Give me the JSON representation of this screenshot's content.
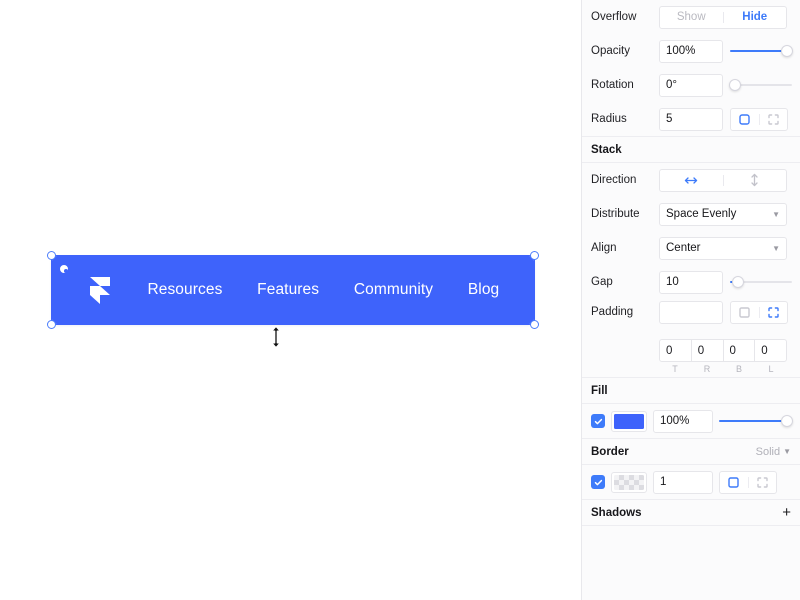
{
  "canvas": {
    "name": "design-canvas",
    "background": "#ffffff",
    "navbar": {
      "fill_color": "#3e63fb",
      "radius": 5,
      "logo_icon": "framer-logo-icon",
      "links": [
        {
          "label": "Resources"
        },
        {
          "label": "Features"
        },
        {
          "label": "Community"
        },
        {
          "label": "Blog"
        }
      ]
    },
    "selection": {
      "handles": [
        "top-left",
        "top-right",
        "bottom-left",
        "bottom-right"
      ],
      "radius_handle": "radius-handle",
      "cursor": "vertical-resize-cursor"
    }
  },
  "panel": {
    "overflow": {
      "label": "Overflow",
      "options": [
        "Show",
        "Hide"
      ],
      "selected": "Hide"
    },
    "opacity": {
      "label": "Opacity",
      "value": "100%",
      "slider_percent": 100
    },
    "rotation": {
      "label": "Rotation",
      "value": "0°",
      "slider_percent": 0
    },
    "radius": {
      "label": "Radius",
      "value": "5",
      "icons": [
        "square-radius-icon",
        "corners-radius-icon"
      ],
      "selected_icon": "square-radius-icon"
    },
    "stack": {
      "title": "Stack",
      "direction": {
        "label": "Direction",
        "icons": [
          "horizontal-arrows-icon",
          "vertical-arrows-icon"
        ],
        "selected_icon": "horizontal-arrows-icon"
      },
      "distribute": {
        "label": "Distribute",
        "value": "Space Evenly"
      },
      "align": {
        "label": "Align",
        "value": "Center"
      },
      "gap": {
        "label": "Gap",
        "value": "10",
        "slider_percent": 8
      },
      "padding": {
        "label": "Padding",
        "value": "",
        "placeholder": "",
        "icons": [
          "uniform-padding-icon",
          "individual-padding-icon"
        ],
        "selected_icon": "individual-padding-icon",
        "sides": [
          {
            "value": "0",
            "label": "T"
          },
          {
            "value": "0",
            "label": "R"
          },
          {
            "value": "0",
            "label": "B"
          },
          {
            "value": "0",
            "label": "L"
          }
        ]
      }
    },
    "fill": {
      "title": "Fill",
      "enabled": true,
      "color": "#3e63fb",
      "opacity": "100%",
      "slider_percent": 100
    },
    "border": {
      "title": "Border",
      "style": "Solid",
      "enabled": true,
      "color": "transparent",
      "width": "1",
      "icons": [
        "uniform-border-icon",
        "individual-border-icon"
      ],
      "selected_icon": "uniform-border-icon"
    },
    "shadows": {
      "title": "Shadows",
      "add_label": "+"
    }
  },
  "colors": {
    "accent": "#3e7bfa",
    "brand_blue": "#3e63fb",
    "panel_bg": "#fbfbfc",
    "border": "#e6e6ea",
    "text": "#1b1b1f",
    "muted": "#b5b5bd"
  }
}
